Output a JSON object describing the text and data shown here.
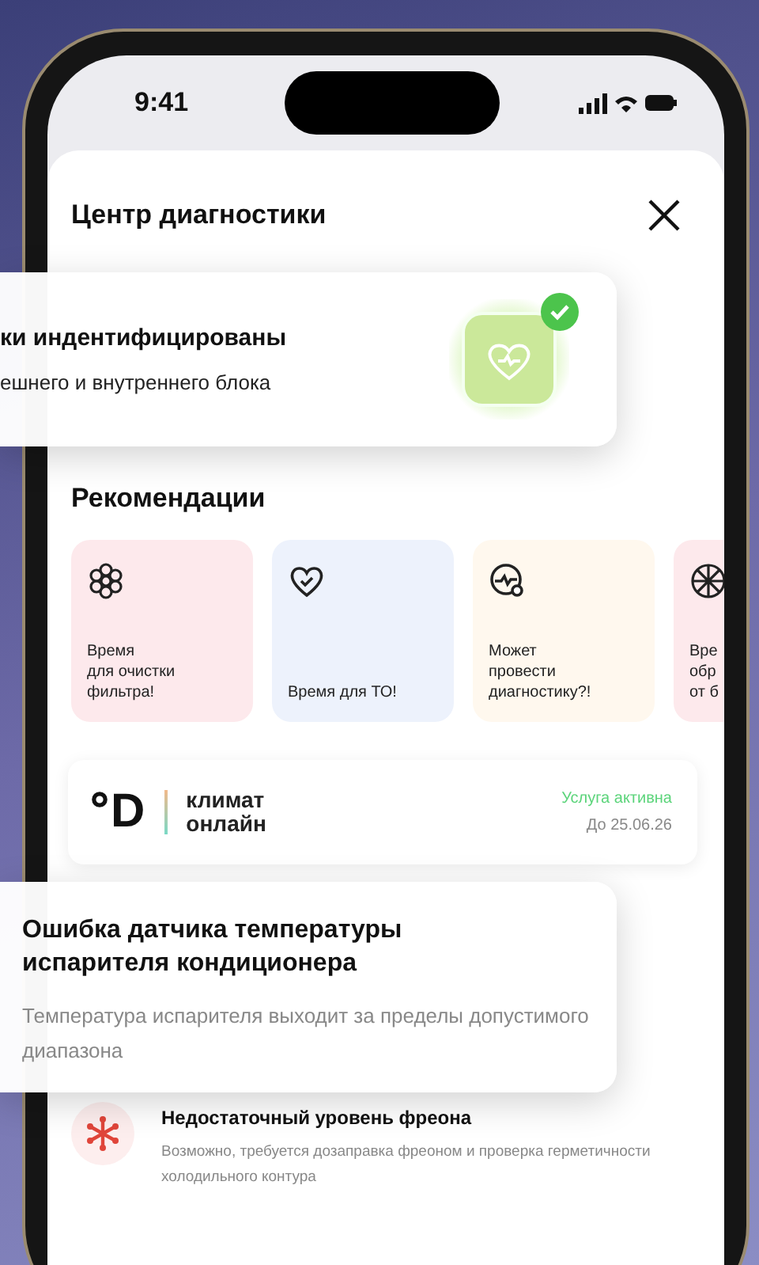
{
  "status_bar": {
    "time": "9:41"
  },
  "sheet": {
    "title": "Центр диагностики"
  },
  "identified_card": {
    "title": "ки индентифицированы",
    "subtitle": "ешнего и внутреннего блока",
    "checked": true
  },
  "recommendations": {
    "title": "Рекомендации",
    "items": [
      {
        "kind": "flower",
        "lines": [
          "Время",
          "для очистки",
          "фильтра!"
        ],
        "color": "#fde9ec"
      },
      {
        "kind": "heart",
        "lines": [
          "Время для ТО!"
        ],
        "color": "#edf2fc"
      },
      {
        "kind": "gauge",
        "lines": [
          "Может",
          "провести",
          "диагностику?!"
        ],
        "color": "#fff8ee"
      },
      {
        "kind": "fan",
        "lines": [
          "Вре",
          "обр",
          "от б"
        ],
        "color": "#fde9ec"
      }
    ]
  },
  "service": {
    "logo_letter": "D",
    "name_lines": [
      "климат",
      "онлайн"
    ],
    "status": "Услуга активна",
    "until": "До 25.06.26"
  },
  "error_card": {
    "title": "Ошибка датчика температуры испарителя кондиционера",
    "description": "Температура испарителя выходит за пределы допустимого диапазона"
  },
  "issues": [
    {
      "kind": "freon",
      "title": "Недостаточный уровень фреона",
      "description": "Возможно, требуется дозаправка фреоном и проверка герметичности холодильного контура"
    }
  ]
}
